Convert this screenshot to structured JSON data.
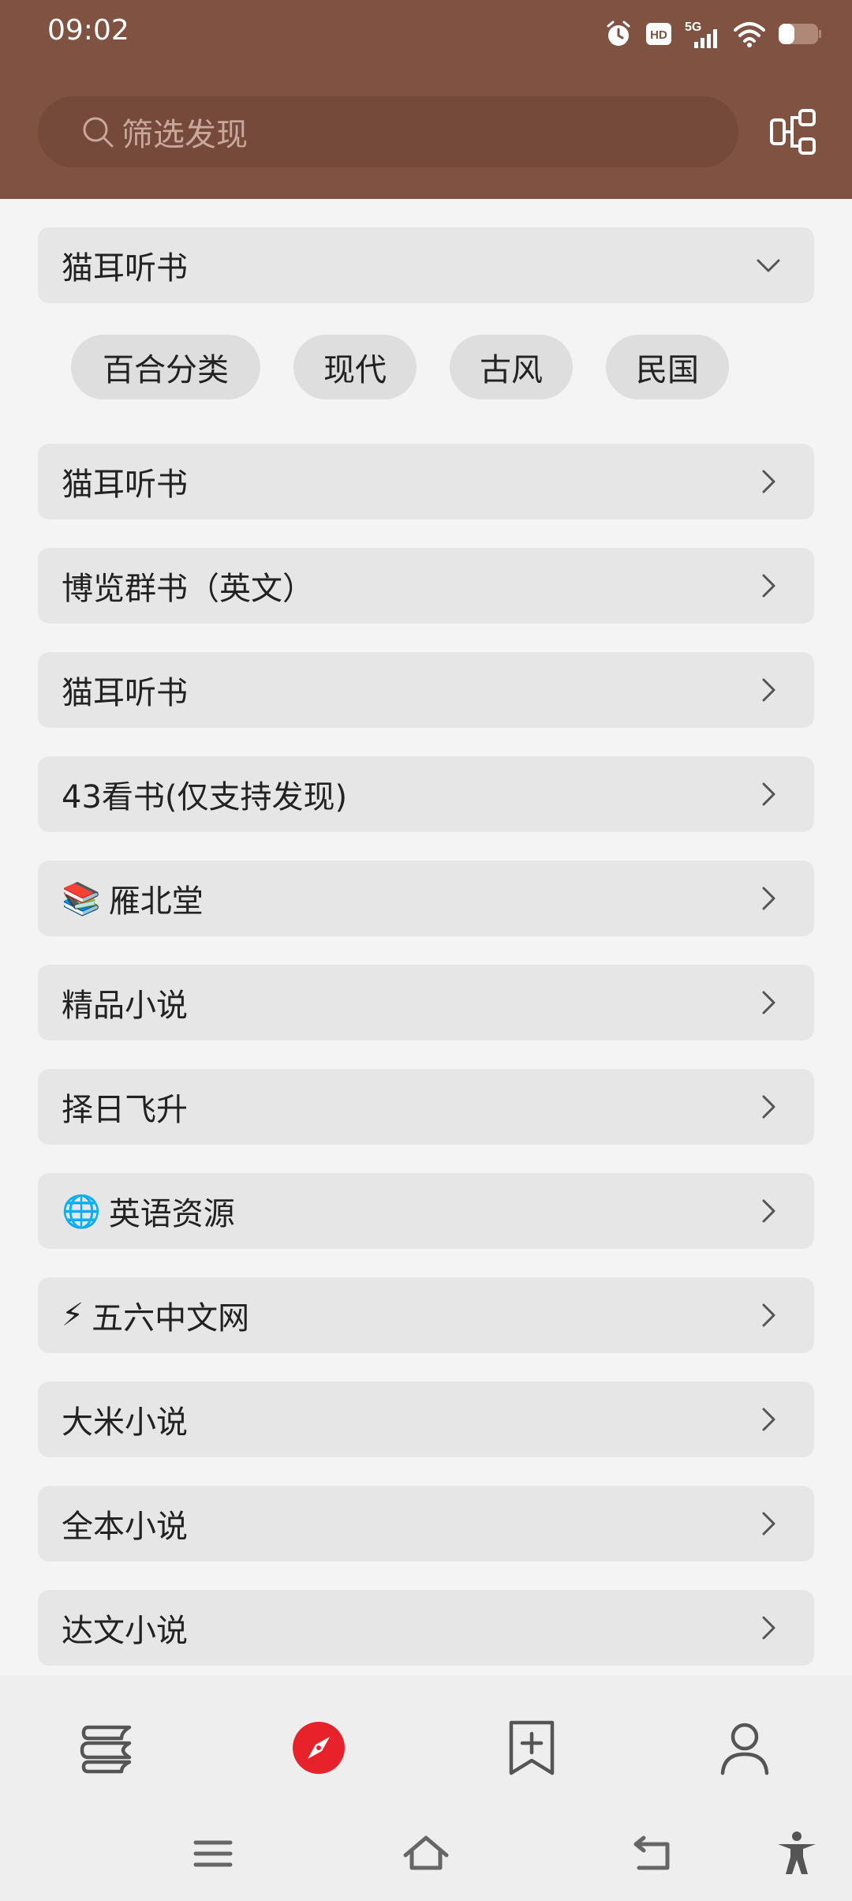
{
  "status_bar": {
    "time": "09:02",
    "icons": [
      "alarm-icon",
      "hd-icon",
      "5g-signal-icon",
      "wifi-icon",
      "battery-icon"
    ],
    "hd_text": "HD",
    "network_text": "5G"
  },
  "header": {
    "search_placeholder": "筛选发现",
    "share_icon": "share-nodes-icon"
  },
  "expanded_group": {
    "label": "猫耳听书",
    "icon": "chevron-down-icon",
    "chips": [
      "百合分类",
      "现代",
      "古风",
      "民国"
    ]
  },
  "list": {
    "items": [
      {
        "label": "猫耳听书",
        "emoji": ""
      },
      {
        "label": "博览群书（英文）",
        "emoji": ""
      },
      {
        "label": "猫耳听书",
        "emoji": ""
      },
      {
        "label": "43看书(仅支持发现)",
        "emoji": ""
      },
      {
        "label": "雁北堂",
        "emoji": "📚"
      },
      {
        "label": "精品小说",
        "emoji": ""
      },
      {
        "label": "择日飞升",
        "emoji": ""
      },
      {
        "label": "英语资源",
        "emoji": "🌐"
      },
      {
        "label": "五六中文网",
        "emoji": "⚡"
      },
      {
        "label": "大米小说",
        "emoji": ""
      },
      {
        "label": "全本小说",
        "emoji": ""
      },
      {
        "label": "达文小说",
        "emoji": ""
      }
    ]
  },
  "bottom_nav": {
    "items": [
      "bookshelf-icon",
      "explore-compass-icon",
      "bookmark-add-icon",
      "profile-icon"
    ],
    "active_color": "#e8222b"
  },
  "system_nav": [
    "menu-icon",
    "home-icon",
    "back-icon",
    "accessibility-icon"
  ],
  "colors": {
    "header_bg": "#7f5242",
    "search_bg": "#754a3a",
    "row_bg": "#e6e6e6",
    "page_bg": "#f4f4f4"
  }
}
